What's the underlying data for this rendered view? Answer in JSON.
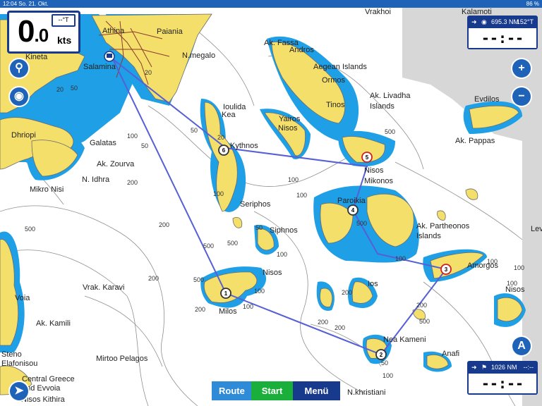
{
  "status_bar": {
    "time": "12:04",
    "date": "So. 21. Okt.",
    "battery": "86 %"
  },
  "speed_box": {
    "value_int": "0",
    "value_dec": ".0",
    "unit": "kts",
    "heading": "--°T"
  },
  "route_box": {
    "distance": "695.3 NM",
    "bearing": "152°T",
    "value": "--:--"
  },
  "finish_box": {
    "distance": "1026 NM",
    "eta": "--:--",
    "value": "--:--"
  },
  "bottom_tabs": {
    "route": "Route",
    "start": "Start",
    "menu": "Menü"
  },
  "colors": {
    "water": "#ffffff",
    "shallow": "#1f9fe6",
    "land": "#f4df6a",
    "route": "#5560d6",
    "button": "#1f63b8",
    "panel": "#173a8c"
  },
  "icons": [
    "search-icon",
    "camera-icon",
    "zoom-in-icon",
    "zoom-out-icon",
    "north-up-icon",
    "locate-icon"
  ],
  "map_labels": [
    {
      "text": "Vrakhoi"
    },
    {
      "text": "Kalamoti"
    },
    {
      "text": "Athina"
    },
    {
      "text": "Paiania"
    },
    {
      "text": "Ak. Fassa"
    },
    {
      "text": "Kineta"
    },
    {
      "text": "Salamina"
    },
    {
      "text": "N.megalo"
    },
    {
      "text": "Andros"
    },
    {
      "text": "Aegean Islands"
    },
    {
      "text": "Ormos"
    },
    {
      "text": "Ak. Livadha"
    },
    {
      "text": "Islands"
    },
    {
      "text": "Evdilos"
    },
    {
      "text": "Tinos"
    },
    {
      "text": "Nisos"
    },
    {
      "text": "Yairos"
    },
    {
      "text": "Kea"
    },
    {
      "text": "Kythnos"
    },
    {
      "text": "Dhriopi"
    },
    {
      "text": "Galatas"
    },
    {
      "text": "Ak. Zourva"
    },
    {
      "text": "N. Idhra"
    },
    {
      "text": "Mikro Nisi"
    },
    {
      "text": "Seriphos"
    },
    {
      "text": "Nisos"
    },
    {
      "text": "Mikonos"
    },
    {
      "text": "Ak. Pappas"
    },
    {
      "text": "Paroikia"
    },
    {
      "text": "Siphnos"
    },
    {
      "text": "Ak. Partheonos"
    },
    {
      "text": "Islands"
    },
    {
      "text": "Amorgos"
    },
    {
      "text": "Nisos"
    },
    {
      "text": "Vrak. Karavi"
    },
    {
      "text": "Nisos"
    },
    {
      "text": "Milos"
    },
    {
      "text": "Ios"
    },
    {
      "text": "Voia"
    },
    {
      "text": "Ak. Kamili"
    },
    {
      "text": "Nea Kameni"
    },
    {
      "text": "Anafi"
    },
    {
      "text": "Mirtoo Pelagos"
    },
    {
      "text": "Steno"
    },
    {
      "text": "Elafonisou"
    },
    {
      "text": "Central Greece"
    },
    {
      "text": "and Evvoia"
    },
    {
      "text": "N.khristiani"
    },
    {
      "text": "Nisos Kithira"
    },
    {
      "text": "Lev"
    },
    {
      "text": "Ioulida"
    }
  ],
  "depth_labels": [
    "20",
    "50",
    "20",
    "50",
    "100",
    "200",
    "500",
    "100",
    "20",
    "50",
    "100",
    "500",
    "100",
    "500",
    "200",
    "100",
    "500",
    "100",
    "200",
    "500",
    "50",
    "100",
    "50",
    "200",
    "500",
    "100",
    "200",
    "100",
    "100",
    "100",
    "200",
    "500",
    "200",
    "100",
    "200"
  ],
  "waypoints": [
    {
      "id": "1",
      "label": "1"
    },
    {
      "id": "2",
      "label": "2"
    },
    {
      "id": "3",
      "label": "3"
    },
    {
      "id": "4",
      "label": "4"
    },
    {
      "id": "5",
      "label": "5"
    },
    {
      "id": "6",
      "label": "6"
    }
  ]
}
